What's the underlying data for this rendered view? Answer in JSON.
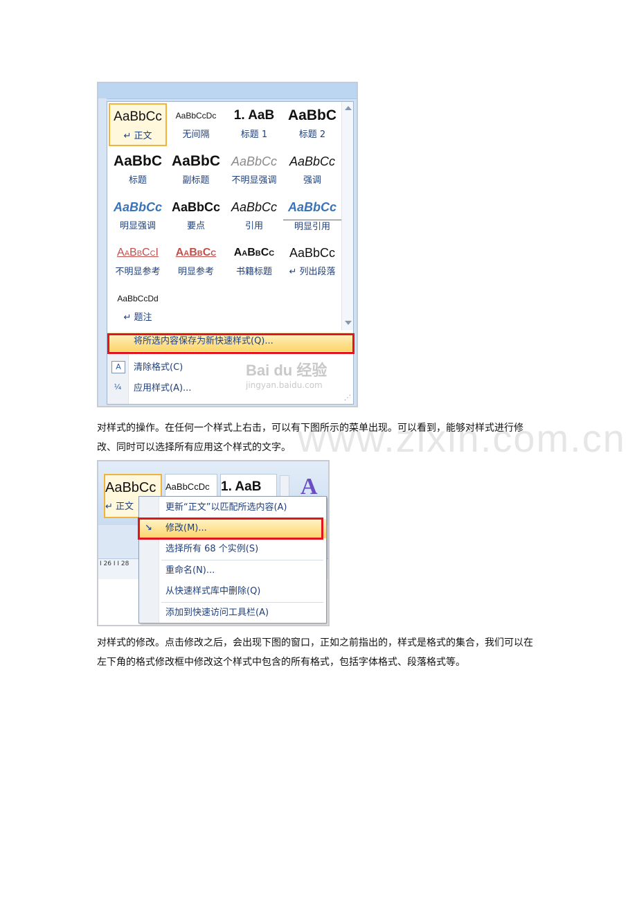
{
  "watermark": "www.zixin.com.cn",
  "screenshot1": {
    "styles": [
      {
        "sample": "AaBbCc",
        "label": "↵ 正文",
        "selected": true
      },
      {
        "sample": "AaBbCcDc",
        "label": "无间隔"
      },
      {
        "sample": "1. AaB",
        "label": "标题 1"
      },
      {
        "sample": "AaBbC",
        "label": "标题 2"
      },
      {
        "sample": "AaBbC",
        "label": "标题"
      },
      {
        "sample": "AaBbC",
        "label": "副标题"
      },
      {
        "sample": "AaBbCc",
        "label": "不明显强调"
      },
      {
        "sample": "AaBbCc",
        "label": "强调"
      },
      {
        "sample": "AaBbCc",
        "label": "明显强调"
      },
      {
        "sample": "AaBbCc",
        "label": "要点"
      },
      {
        "sample": "AaBbCc",
        "label": "引用"
      },
      {
        "sample": "AaBbCc",
        "label": "明显引用"
      },
      {
        "sample": "AaBbCcI",
        "label": "不明显参考"
      },
      {
        "sample": "AaBbCc",
        "label": "明显参考"
      },
      {
        "sample": "AaBbCc",
        "label": "书籍标题"
      },
      {
        "sample": "AaBbCc",
        "label": "↵ 列出段落"
      },
      {
        "sample": "AaBbCcDd",
        "label": "↵ 题注"
      }
    ],
    "menu": {
      "save_as": "将所选内容保存为新快速样式(Q)...",
      "clear": "清除格式(C)",
      "apply": "应用样式(A)..."
    },
    "logo": {
      "brand": "Bai du 经验",
      "url": "jingyan.baidu.com"
    }
  },
  "paragraph1": "对样式的操作。在任何一个样式上右击，可以有下图所示的菜单出现。可以看到，能够对样式进行修改、同时可以选择所有应用这个样式的文字。",
  "screenshot2": {
    "tiles": [
      {
        "sample": "AaBbCc",
        "label": "↵ 正文"
      },
      {
        "sample": "AaBbCcDc"
      },
      {
        "sample": "1. AaB"
      }
    ],
    "ruler_marks": "I 26 I  I 28",
    "context_menu": {
      "update": "更新“正文”以匹配所选内容(A)",
      "modify": "修改(M)...",
      "select_all": "选择所有 68 个实例(S)",
      "rename": "重命名(N)...",
      "remove": "从快速样式库中删除(Q)",
      "add_toolbar": "添加到快速访问工具栏(A)"
    }
  },
  "paragraph2": "对样式的修改。点击修改之后，会出现下图的窗口，正如之前指出的，样式是格式的集合，我们可以在左下角的格式修改框中修改这个样式中包含的所有格式，包括字体格式、段落格式等。",
  "colors": {
    "highlight": "#fcd46a",
    "red_box": "#e0151f",
    "label_blue": "#1f3f7a"
  }
}
